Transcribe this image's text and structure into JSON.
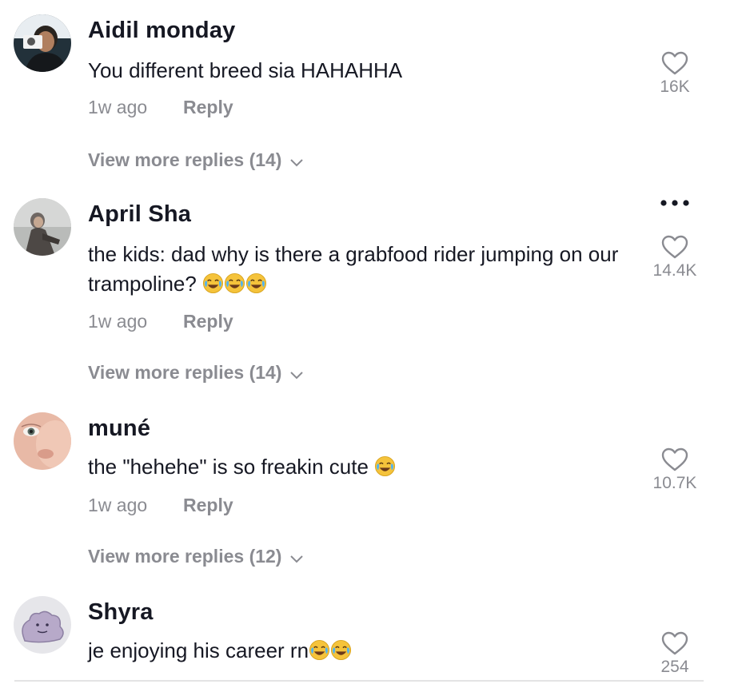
{
  "comments": [
    {
      "username": "Aidil monday",
      "text": "You different breed sia HAHAHHA",
      "time": "1w ago",
      "reply_label": "Reply",
      "view_replies": "View more replies (14)",
      "likes": "16K",
      "emoji_count": 0
    },
    {
      "username": "April Sha",
      "text": "the kids: dad why is there a grabfood rider jumping on our trampoline?",
      "time": "1w ago",
      "reply_label": "Reply",
      "view_replies": "View more replies (14)",
      "likes": "14.4K",
      "emoji_count": 3
    },
    {
      "username": "muné",
      "text": "the \"hehehe\" is so freakin cute",
      "time": "1w ago",
      "reply_label": "Reply",
      "view_replies": "View more replies (12)",
      "likes": "10.7K",
      "emoji_count": 1
    },
    {
      "username": "Shyra",
      "text": "je enjoying his career rn",
      "likes": "254",
      "emoji_count": 2
    }
  ],
  "icons": {
    "heart": "heart-icon",
    "chevron": "chevron-down-icon",
    "more": "more-options-icon",
    "emoji": "face-with-tears-of-joy-emoji"
  },
  "colors": {
    "text": "#161823",
    "muted": "#8a8b91",
    "emoji_face": "#f5c33b"
  }
}
